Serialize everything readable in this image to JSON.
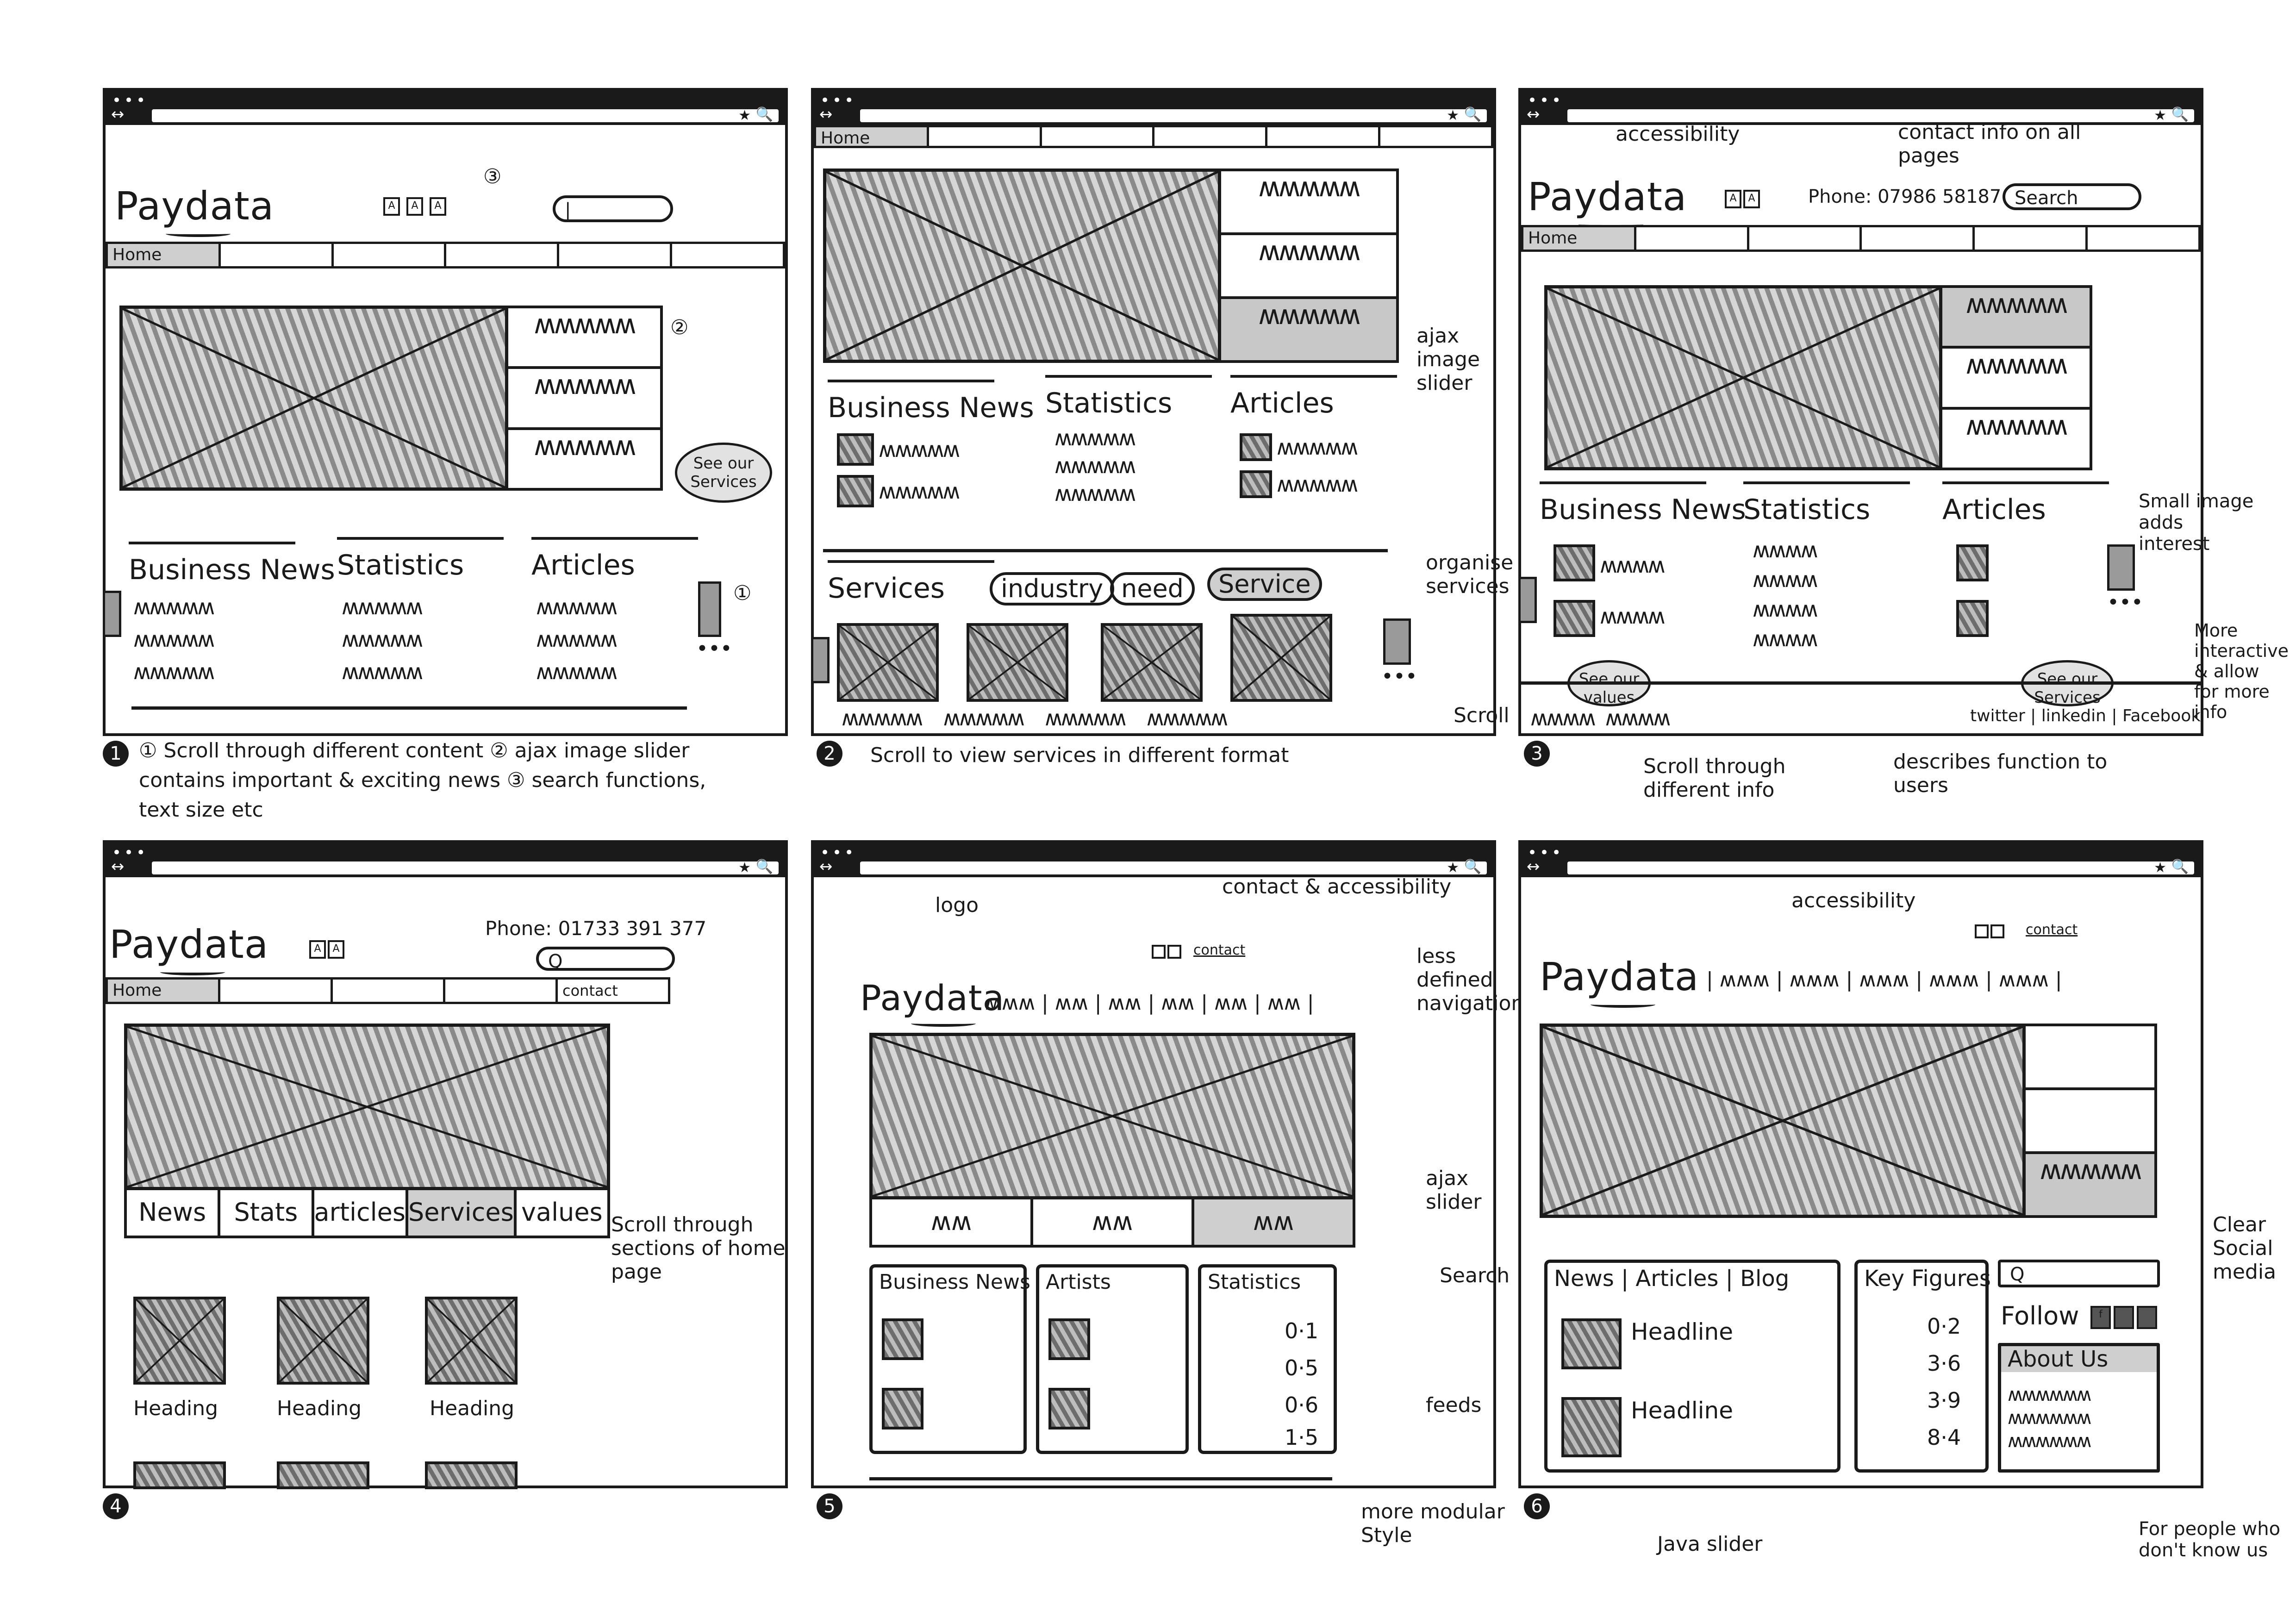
{
  "brand": {
    "logo_text": "Paydata"
  },
  "browser": {
    "dots": "•••",
    "nav_arrows": "↔",
    "star": "★",
    "search_glyph": "🔍"
  },
  "panel1": {
    "nav_home": "Home",
    "thumb_squiggles": [
      "ʍʍʍʍʍ",
      "ʍʍʍʍʍ",
      "ʍʍʍʍʍ"
    ],
    "headings": [
      "Business News",
      "Statistics",
      "Articles"
    ],
    "cloud": "See our Services",
    "squig": "ʍʍʍʍʍ",
    "markers": [
      "①",
      "②",
      "③"
    ]
  },
  "panel1_caption": {
    "number": "1",
    "line1": "① Scroll through different content ② ajax image slider",
    "line2": "contains important & exciting news ③ search functions,",
    "line3": "text size etc"
  },
  "panel2": {
    "nav_home": "Home",
    "headings": [
      "Business News",
      "Statistics",
      "Articles"
    ],
    "services_label": "Services",
    "pills": [
      "industry",
      "need",
      "Service"
    ],
    "squig": "ʍʍʍʍʍ"
  },
  "panel2_caption": {
    "number": "2",
    "text": "Scroll to view services in different format"
  },
  "panel2_notes": {
    "ajax": "ajax image slider",
    "organise": "organise services",
    "scroll": "Scroll"
  },
  "panel3": {
    "phone": "Phone: 07986 58187",
    "search_label": "Search",
    "nav_home": "Home",
    "headings": [
      "Business News",
      "Statistics",
      "Articles"
    ],
    "cloud_values": "See our values",
    "cloud_services": "See our Services",
    "social": "twitter | linkedin | Facebook",
    "squig": "ʍʍʍʍ"
  },
  "panel3_caption": {
    "number": "3"
  },
  "panel3_notes": {
    "accessibility": "accessibility",
    "contact": "contact info on all pages",
    "small_image": "Small image adds interest",
    "interactive": "More interactive & allow for more info",
    "scroll": "Scroll through different info",
    "describes": "describes function to users"
  },
  "panel4": {
    "phone": "Phone: 01733 391 377",
    "nav_home": "Home",
    "nav_contact": "contact",
    "tabs": [
      "News",
      "Stats",
      "articles",
      "Services",
      "values"
    ],
    "card_headings": [
      "Heading",
      "Heading",
      "Heading"
    ]
  },
  "panel4_caption": {
    "number": "4"
  },
  "panel4_notes": {
    "scroll": "Scroll through sections of home page"
  },
  "panel5": {
    "contact": "contact",
    "nav": "ʍʍʍ | ʍʍ | ʍʍ | ʍʍ | ʍʍ | ʍʍ |",
    "modules": [
      "Business News",
      "Artists",
      "Statistics"
    ],
    "stats": [
      "0·1",
      "0·5",
      "0·6",
      "1·5"
    ],
    "squig": "ʍʍ"
  },
  "panel5_caption": {
    "number": "5"
  },
  "panel5_notes": {
    "logo": "logo",
    "contact": "contact & accessibility",
    "nav": "less defined navigation",
    "ajax": "ajax slider",
    "search": "Search",
    "feeds": "feeds",
    "modular": "more modular Style"
  },
  "panel6": {
    "contact": "contact",
    "nav": "| ʍʍʍ | ʍʍʍ | ʍʍʍ | ʍʍʍ | ʍʍʍ |",
    "news_tabs": "News | Articles | Blog",
    "headlines": [
      "Headline",
      "Headline"
    ],
    "key_figures": "Key Figures",
    "figures": [
      "0·2",
      "3·6",
      "3·9",
      "8·4"
    ],
    "follow": "Follow",
    "about": "About Us",
    "squig": "ʍʍʍʍʍʍ"
  },
  "panel6_caption": {
    "number": "6"
  },
  "panel6_notes": {
    "accessibility": "accessibility",
    "social": "Clear Social media",
    "java": "Java slider",
    "people": "For people who don't know us"
  }
}
